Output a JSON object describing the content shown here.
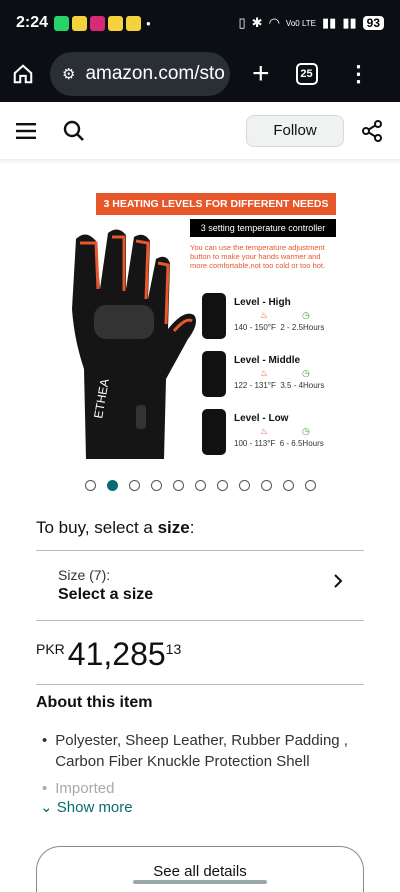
{
  "status": {
    "time": "2:24",
    "network": "Vo0 LTE",
    "battery": "93"
  },
  "browser": {
    "url": "amazon.com/sto",
    "tabs_count": "25"
  },
  "store": {
    "follow_label": "Follow"
  },
  "product_image": {
    "banner": "3 HEATING LEVELS FOR DIFFERENT NEEDS",
    "controller_label": "3 setting temperature controller",
    "note": "You can use the temperature adjustment button to make your hands warmer and more comfortable,not too cold or too hot.",
    "brand": "ETHEA",
    "levels": [
      {
        "name": "Level - High",
        "temp": "140 - 150°F",
        "hours": "2 - 2.5Hours"
      },
      {
        "name": "Level - Middle",
        "temp": "122 - 131°F",
        "hours": "3.5 - 4Hours"
      },
      {
        "name": "Level - Low",
        "temp": "100 - 113°F",
        "hours": "6 - 6.5Hours"
      }
    ],
    "carousel_count": 11,
    "carousel_active_index": 1
  },
  "buy": {
    "prefix": "To buy, select a ",
    "emph": "size",
    "suffix": ":"
  },
  "size": {
    "label": "Size (7):",
    "value": "Select a size"
  },
  "price": {
    "currency": "PKR",
    "whole": "41,285",
    "fraction": "13"
  },
  "about": {
    "title": "About this item",
    "bullets": [
      "Polyester, Sheep Leather, Rubber Padding , Carbon Fiber Knuckle Protection Shell",
      "Imported"
    ],
    "show_more": "Show more"
  },
  "see_all": "See all details",
  "colors": {
    "accent": "#e8572b",
    "link": "#0a6b74"
  }
}
